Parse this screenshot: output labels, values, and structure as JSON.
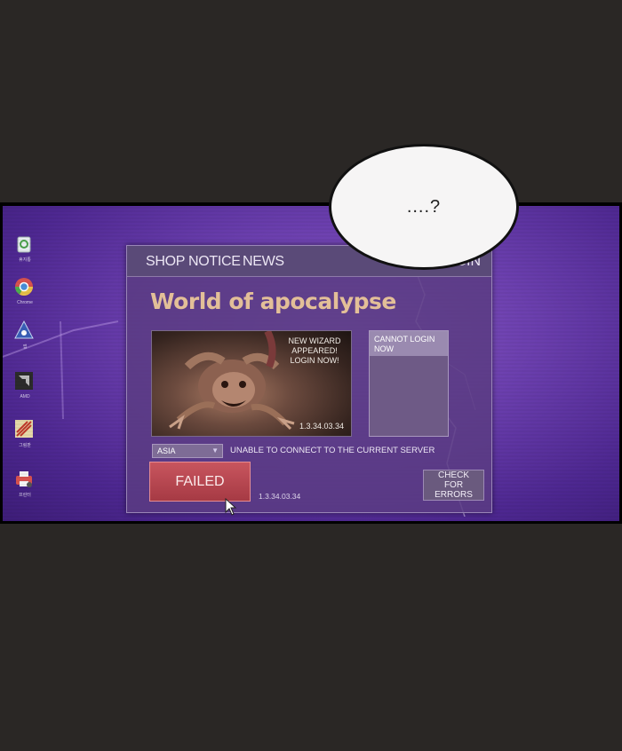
{
  "desktop": {
    "icons": [
      {
        "name": "recycle-bin-icon",
        "label": "휴지통"
      },
      {
        "name": "chrome-icon",
        "label": "Chrome"
      },
      {
        "name": "app-icon",
        "label": "앱"
      },
      {
        "name": "amd-icon",
        "label": "AMD"
      },
      {
        "name": "paint-icon",
        "label": "그림판"
      },
      {
        "name": "printer-icon",
        "label": "프린터"
      }
    ]
  },
  "window": {
    "nav": [
      "SHOP",
      "NOTICE",
      "NEWS"
    ],
    "login_label": "LOGIN",
    "game_title": "World of apocalypse",
    "banner": {
      "text": "NEW WIZARD APPEARED! LOGIN NOW!",
      "version": "1.3.34.03.34"
    },
    "status": {
      "text": "CANNOT LOGIN NOW"
    },
    "server": {
      "selected": "ASIA"
    },
    "connect_message": "UNABLE TO CONNECT TO THE CURRENT SERVER",
    "failed_button": "FAILED",
    "version": "1.3.34.03.34",
    "check_button": "CHECK FOR ERRORS"
  },
  "speech_bubble": {
    "text": "....?"
  }
}
